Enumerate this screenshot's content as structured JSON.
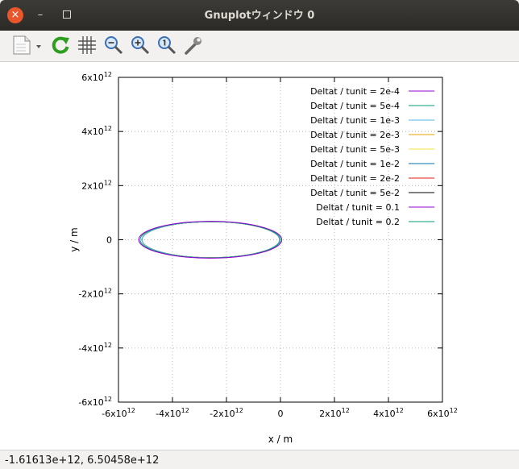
{
  "window": {
    "title": "Gnuplotウィンドウ 0",
    "close_glyph": "×",
    "minimize_glyph": "–"
  },
  "toolbar": {
    "tools": [
      "copy-to-clipboard-icon",
      "replot-icon",
      "grid-icon",
      "zoom-out-icon",
      "zoom-in-icon",
      "zoom-original-icon",
      "settings-icon"
    ]
  },
  "statusbar": {
    "coords": "-1.61613e+12,  6.50458e+12"
  },
  "chart_data": {
    "type": "line",
    "xlabel": "x / m",
    "ylabel": "y / m",
    "xlim": [
      -6000000000000.0,
      6000000000000.0
    ],
    "ylim": [
      -6000000000000.0,
      6000000000000.0
    ],
    "grid": true,
    "legend_position": "top-right",
    "x_ticks": [
      {
        "value": -6000000000000.0,
        "mant": "-6x10",
        "exp": "12"
      },
      {
        "value": -4000000000000.0,
        "mant": "-4x10",
        "exp": "12"
      },
      {
        "value": -2000000000000.0,
        "mant": "-2x10",
        "exp": "12"
      },
      {
        "value": 0,
        "mant": "0",
        "exp": ""
      },
      {
        "value": 2000000000000.0,
        "mant": "2x10",
        "exp": "12"
      },
      {
        "value": 4000000000000.0,
        "mant": "4x10",
        "exp": "12"
      },
      {
        "value": 6000000000000.0,
        "mant": "6x10",
        "exp": "12"
      }
    ],
    "y_ticks": [
      {
        "value": 6000000000000.0,
        "mant": "6x10",
        "exp": "12"
      },
      {
        "value": 4000000000000.0,
        "mant": "4x10",
        "exp": "12"
      },
      {
        "value": 2000000000000.0,
        "mant": "2x10",
        "exp": "12"
      },
      {
        "value": 0,
        "mant": "0",
        "exp": ""
      },
      {
        "value": -2000000000000.0,
        "mant": "-2x10",
        "exp": "12"
      },
      {
        "value": -4000000000000.0,
        "mant": "-4x10",
        "exp": "12"
      },
      {
        "value": -6000000000000.0,
        "mant": "-6x10",
        "exp": "12"
      }
    ],
    "series": [
      {
        "name": "Deltat / tunit = 2e-4",
        "color": "#9400d3",
        "orbit": {
          "cx": -2600000000000.0,
          "cy": 0,
          "rx": 2650000000000.0,
          "ry": 680000000000.0
        }
      },
      {
        "name": "Deltat / tunit = 5e-4",
        "color": "#009e73",
        "orbit": {
          "cx": -2600000000000.0,
          "cy": 0,
          "rx": 2600000000000.0,
          "ry": 670000000000.0
        }
      },
      {
        "name": "Deltat / tunit = 1e-3",
        "color": "#56b4e9",
        "orbit": {
          "cx": -2580000000000.0,
          "cy": 0,
          "rx": 2550000000000.0,
          "ry": 665000000000.0
        }
      },
      {
        "name": "Deltat / tunit = 2e-3",
        "color": "#e69f00",
        "orbit": {
          "cx": -2580000000000.0,
          "cy": 0,
          "rx": 2550000000000.0,
          "ry": 665000000000.0
        }
      },
      {
        "name": "Deltat / tunit = 5e-3",
        "color": "#f0e442",
        "orbit": {
          "cx": -2580000000000.0,
          "cy": 0,
          "rx": 2550000000000.0,
          "ry": 665000000000.0
        }
      },
      {
        "name": "Deltat / tunit = 1e-2",
        "color": "#0072b2",
        "orbit": {
          "cx": -2580000000000.0,
          "cy": 0,
          "rx": 2550000000000.0,
          "ry": 665000000000.0
        }
      },
      {
        "name": "Deltat / tunit = 2e-2",
        "color": "#e51e10",
        "orbit": {
          "cx": -2580000000000.0,
          "cy": 0,
          "rx": 2550000000000.0,
          "ry": 665000000000.0
        }
      },
      {
        "name": "Deltat / tunit = 5e-2",
        "color": "#000000",
        "orbit": {
          "cx": -2580000000000.0,
          "cy": 0,
          "rx": 2550000000000.0,
          "ry": 665000000000.0
        }
      },
      {
        "name": "Deltat / tunit = 0.1",
        "color": "#9400d3",
        "orbit": {
          "cx": -2580000000000.0,
          "cy": 0,
          "rx": 2550000000000.0,
          "ry": 665000000000.0
        }
      },
      {
        "name": "Deltat / tunit = 0.2",
        "color": "#009e73",
        "orbit": {
          "cx": -2580000000000.0,
          "cy": 0,
          "rx": 2550000000000.0,
          "ry": 665000000000.0
        }
      }
    ]
  }
}
